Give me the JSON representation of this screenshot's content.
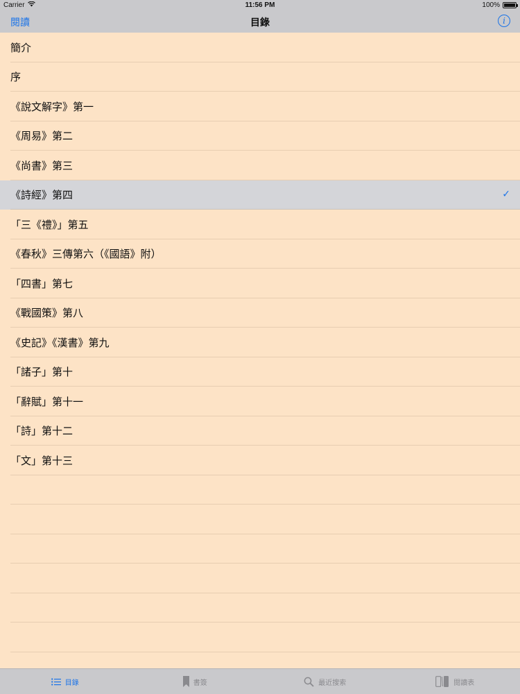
{
  "status_bar": {
    "carrier": "Carrier",
    "time": "11:56 PM",
    "battery": "100%"
  },
  "nav": {
    "back_label": "閱讀",
    "title": "目錄",
    "info_icon": "info-icon"
  },
  "toc": {
    "items": [
      {
        "label": "簡介",
        "selected": false
      },
      {
        "label": "序",
        "selected": false
      },
      {
        "label": "《說文解字》第一",
        "selected": false
      },
      {
        "label": "《周易》第二",
        "selected": false
      },
      {
        "label": "《尚書》第三",
        "selected": false
      },
      {
        "label": "《詩經》第四",
        "selected": true
      },
      {
        "label": "「三《禮》」第五",
        "selected": false
      },
      {
        "label": "《春秋》三傳第六（《國語》附）",
        "selected": false
      },
      {
        "label": "「四書」第七",
        "selected": false
      },
      {
        "label": "《戰國策》第八",
        "selected": false
      },
      {
        "label": "《史記》《漢書》第九",
        "selected": false
      },
      {
        "label": "「諸子」第十",
        "selected": false
      },
      {
        "label": "「辭賦」第十一",
        "selected": false
      },
      {
        "label": "「詩」第十二",
        "selected": false
      },
      {
        "label": "「文」第十三",
        "selected": false
      }
    ],
    "check_mark": "✓"
  },
  "tabs": [
    {
      "label": "目錄",
      "icon": "list-icon",
      "active": true
    },
    {
      "label": "書簽",
      "icon": "bookmark-icon",
      "active": false
    },
    {
      "label": "最近搜索",
      "icon": "search-icon",
      "active": false
    },
    {
      "label": "閱讀表",
      "icon": "reading-table-icon",
      "active": false
    }
  ],
  "colors": {
    "accent": "#1a73e8",
    "background": "#fde3c6",
    "bar": "#c9c9cc",
    "selected_row": "#d4d5d9"
  }
}
